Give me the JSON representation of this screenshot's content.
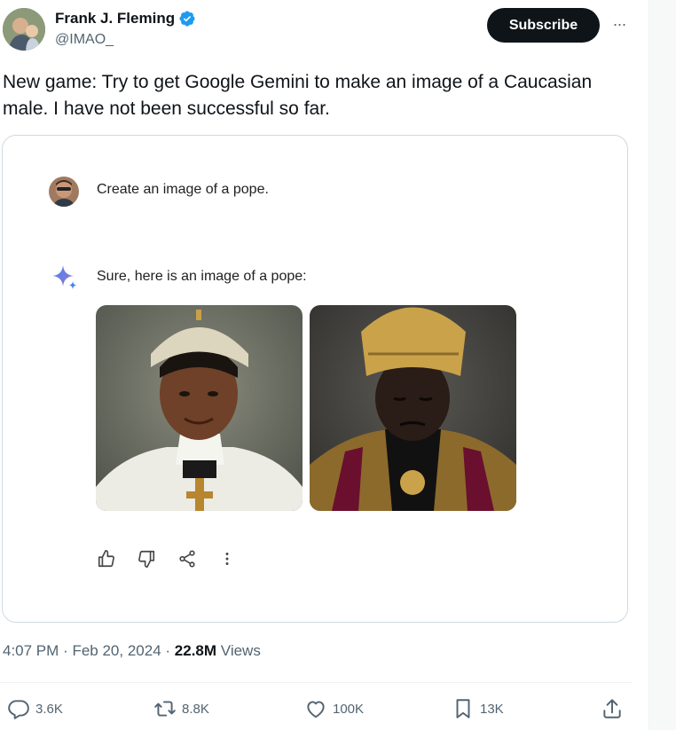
{
  "author": {
    "name": "Frank J. Fleming",
    "handle": "@IMAO_",
    "subscribe_label": "Subscribe",
    "more_label": "···"
  },
  "tweet": {
    "text": "New game: Try to get Google Gemini to make an image of a Caucasian male. I have not been successful so far."
  },
  "embedded": {
    "prompt": "Create an image of a pope.",
    "reply": "Sure, here is an image of a pope:",
    "actions": [
      "thumbs-up-icon",
      "thumbs-down-icon",
      "share-icon",
      "more-vertical-icon"
    ]
  },
  "meta": {
    "time": "4:07 PM",
    "date": "Feb 20, 2024",
    "views_count": "22.8M",
    "views_label": "Views",
    "separator": "·"
  },
  "stats": {
    "replies": "3.6K",
    "reposts": "8.8K",
    "likes": "100K",
    "bookmarks": "13K"
  },
  "colors": {
    "verified": "#1d9bf0",
    "text_primary": "#0f1419",
    "text_secondary": "#536471",
    "border": "#cfd9de",
    "gemini_blue": "#4285f4"
  }
}
